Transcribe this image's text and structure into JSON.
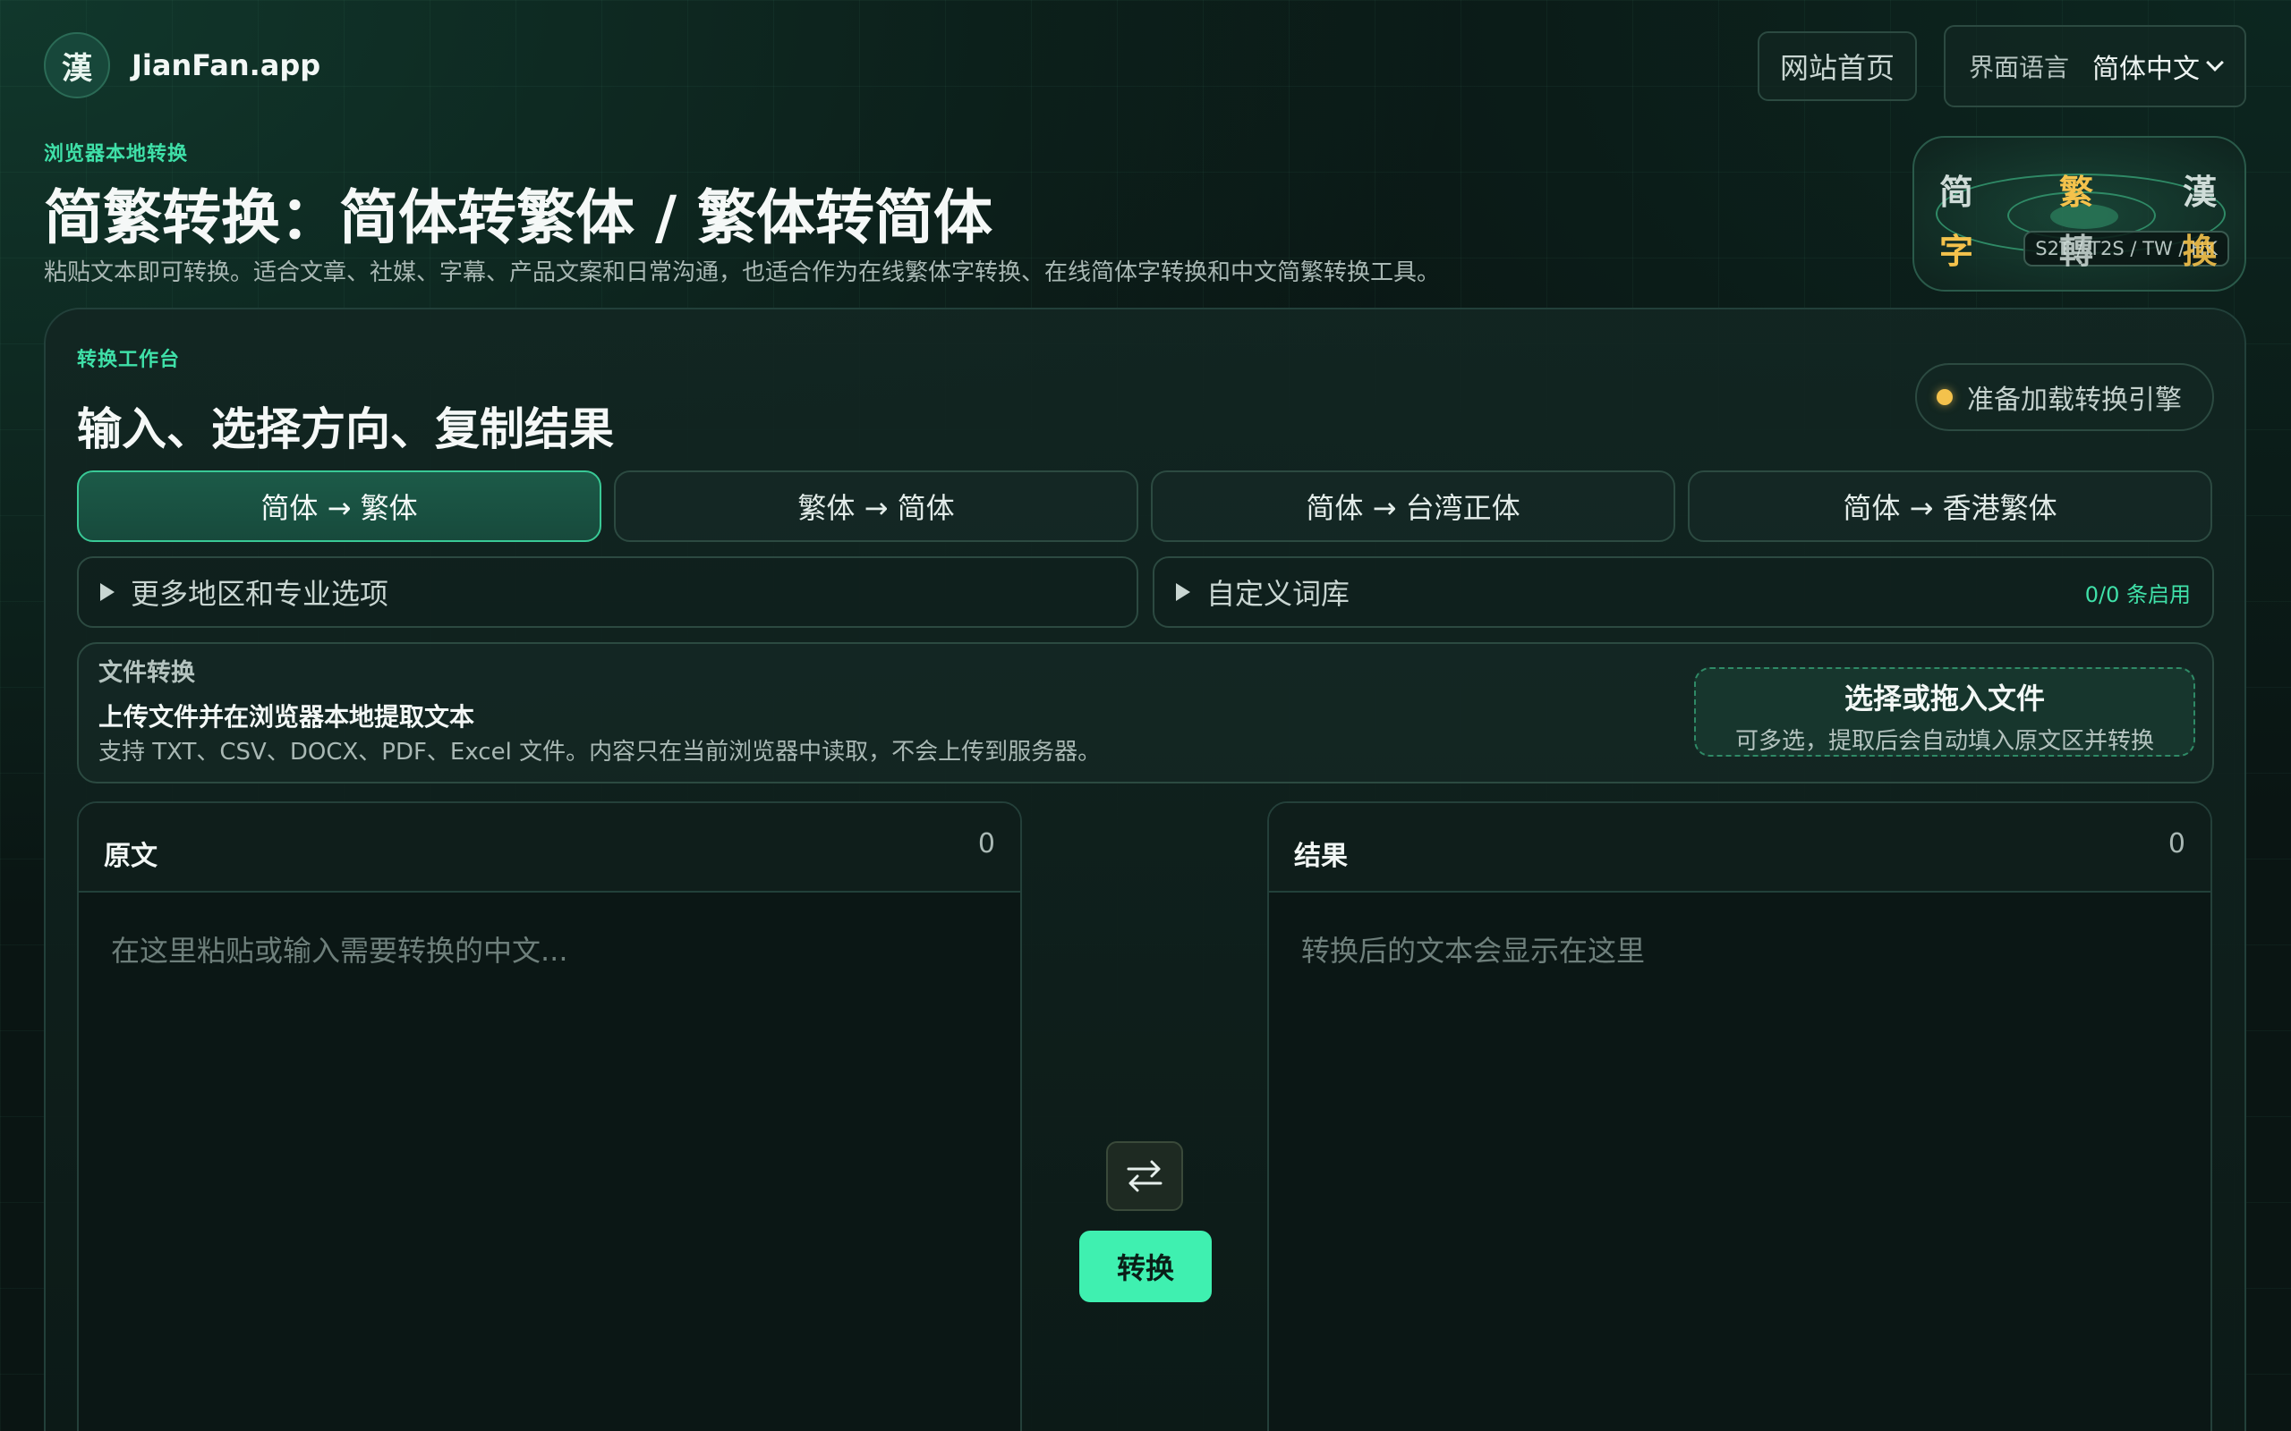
{
  "brand": {
    "logo_char": "漢",
    "name": "JianFan.app"
  },
  "header": {
    "home_label": "网站首页",
    "lang_label": "界面语言",
    "lang_value": "简体中文"
  },
  "hero": {
    "eyebrow": "浏览器本地转换",
    "title": "简繁转换：简体转繁体 / 繁体转简体",
    "subtitle": "粘贴文本即可转换。适合文章、社媒、字幕、产品文案和日常沟通，也适合作为在线繁体字转换、在线简体字转换和中文简繁转换工具。",
    "badge": {
      "chars": [
        "简",
        "繁",
        "漢",
        "字",
        "轉",
        "換"
      ],
      "tag": "S2T / T2S / TW / HK"
    }
  },
  "workbench": {
    "eyebrow": "转换工作台",
    "title": "输入、选择方向、复制结果",
    "status": "准备加载转换引擎",
    "directions": [
      {
        "label": "简体 → 繁体",
        "active": true
      },
      {
        "label": "繁体 → 简体",
        "active": false
      },
      {
        "label": "简体 → 台湾正体",
        "active": false
      },
      {
        "label": "简体 → 香港繁体",
        "active": false
      }
    ],
    "more_options": "更多地区和专业选项",
    "custom_dict": "自定义词库",
    "dict_count": "0/0 条启用"
  },
  "file": {
    "label": "文件转换",
    "title": "上传文件并在浏览器本地提取文本",
    "desc": "支持 TXT、CSV、DOCX、PDF、Excel 文件。内容只在当前浏览器中读取，不会上传到服务器。",
    "drop_title": "选择或拖入文件",
    "drop_sub": "可多选，提取后会自动填入原文区并转换"
  },
  "source": {
    "title": "原文",
    "count": "0",
    "placeholder": "在这里粘贴或输入需要转换的中文..."
  },
  "result": {
    "title": "结果",
    "count": "0",
    "placeholder": "转换后的文本会显示在这里"
  },
  "actions": {
    "convert": "转换"
  },
  "colors": {
    "accent": "#3fe0a8",
    "button": "#3ff0b0",
    "status_dot": "#f4c24c",
    "bg": "#0a1513"
  }
}
